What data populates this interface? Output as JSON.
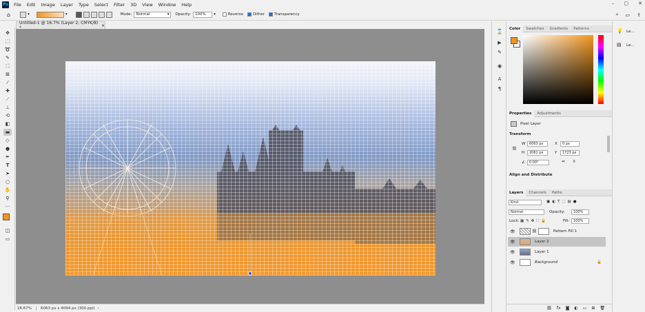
{
  "app": {
    "logo": "Ps"
  },
  "menu": [
    "File",
    "Edit",
    "Image",
    "Layer",
    "Type",
    "Select",
    "Filter",
    "3D",
    "View",
    "Window",
    "Help"
  ],
  "window_controls": {
    "minimize": "–",
    "restore": "▢",
    "close": "✕"
  },
  "options": {
    "mode_label": "Mode:",
    "mode_value": "Normal",
    "opacity_label": "Opacity:",
    "opacity_value": "100%",
    "reverse_label": "Reverse",
    "dither_label": "Dither",
    "transparency_label": "Transparency"
  },
  "document": {
    "tab_title": "Untitled-1 @ 16.7% (Layer 2, CMYK/8) *",
    "tab_close": "×",
    "zoom": "16.67%",
    "size": "6063 px x 4094 px (300 ppi)"
  },
  "color_panel": {
    "tabs": [
      "Color",
      "Swatches",
      "Gradients",
      "Patterns"
    ],
    "foreground": "#f2961f",
    "background": "#ffffff",
    "hue_color": "#f2961f"
  },
  "properties_panel": {
    "tabs": [
      "Properties",
      "Adjustments"
    ],
    "layer_type": "Pixel Layer",
    "transform_label": "Transform",
    "w_label": "W",
    "w_value": "6063 px",
    "h_label": "H",
    "h_value": "2061 px",
    "x_label": "X",
    "x_value": "0 px",
    "y_label": "Y",
    "y_value": "1723 px",
    "angle_value": "0.00°",
    "align_label": "Align and Distribute"
  },
  "layers_panel": {
    "tabs": [
      "Layers",
      "Channels",
      "Paths"
    ],
    "filter_value": "Kind",
    "blend_mode": "Normal",
    "opacity_label": "Opacity:",
    "opacity_value": "100%",
    "lock_label": "Lock:",
    "fill_label": "Fill:",
    "fill_value": "100%",
    "layers": [
      {
        "name": "Pattern Fill 1",
        "selected": false
      },
      {
        "name": "Layer 2",
        "selected": true
      },
      {
        "name": "Layer 1",
        "selected": false
      },
      {
        "name": "Background",
        "selected": false
      }
    ],
    "bottom_icons": [
      "link-icon",
      "fx-icon",
      "mask-icon",
      "adjustment-icon",
      "folder-icon",
      "new-layer-icon",
      "trash-icon"
    ]
  },
  "right_panel": {
    "items": [
      {
        "label": "Le..."
      },
      {
        "label": "Le..."
      }
    ]
  }
}
